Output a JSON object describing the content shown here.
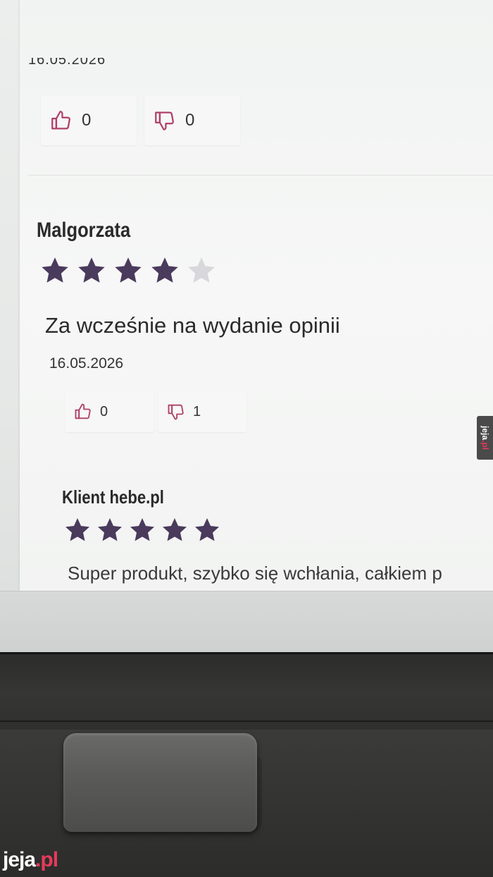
{
  "previous_review": {
    "date_partial": "16.05.2026",
    "likes": "0",
    "dislikes": "0"
  },
  "reviews": [
    {
      "author": "Malgorzata",
      "rating": 4,
      "title": "Za wcześnie na wydanie opinii",
      "date": "16.05.2026",
      "likes": "0",
      "dislikes": "1"
    },
    {
      "author": "Klient hebe.pl",
      "rating": 5,
      "text": "Super produkt, szybko się wchłania, całkiem p"
    }
  ],
  "icons": {
    "like": "thumbs-up-icon",
    "dislike": "thumbs-down-icon",
    "star": "star-icon"
  },
  "colors": {
    "star_filled": "#4a3a5c",
    "star_empty": "#d8d8dc",
    "vote_icon": "#b0406a"
  },
  "watermark": {
    "brand": "jeja",
    "tld": ".pl"
  }
}
